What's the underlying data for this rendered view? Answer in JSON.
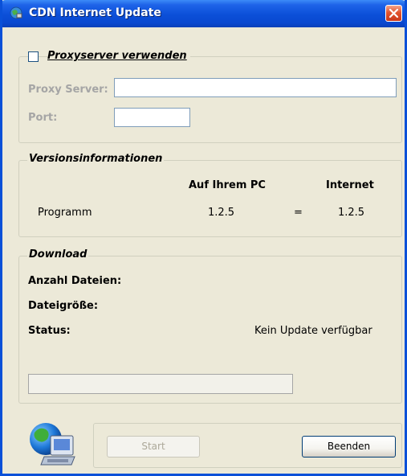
{
  "window": {
    "title": "CDN Internet Update"
  },
  "proxy": {
    "checkbox_label": "Proxyserver verwenden",
    "server_label": "Proxy Server:",
    "server_value": "",
    "port_label": "Port:",
    "port_value": ""
  },
  "versions": {
    "legend": "Versionsinformationen",
    "col_local": "Auf Ihrem PC",
    "col_internet": "Internet",
    "row_label": "Programm",
    "local_version": "1.2.5",
    "comparator": "=",
    "internet_version": "1.2.5"
  },
  "download": {
    "legend": "Download",
    "files_label": "Anzahl Dateien:",
    "size_label": "Dateigröße:",
    "status_label": "Status:",
    "status_value": "Kein Update verfügbar",
    "progress": 0
  },
  "buttons": {
    "start": "Start",
    "quit": "Beenden"
  },
  "colors": {
    "titlebar": "#0A48CF",
    "window_bg": "#ECE9D8"
  }
}
